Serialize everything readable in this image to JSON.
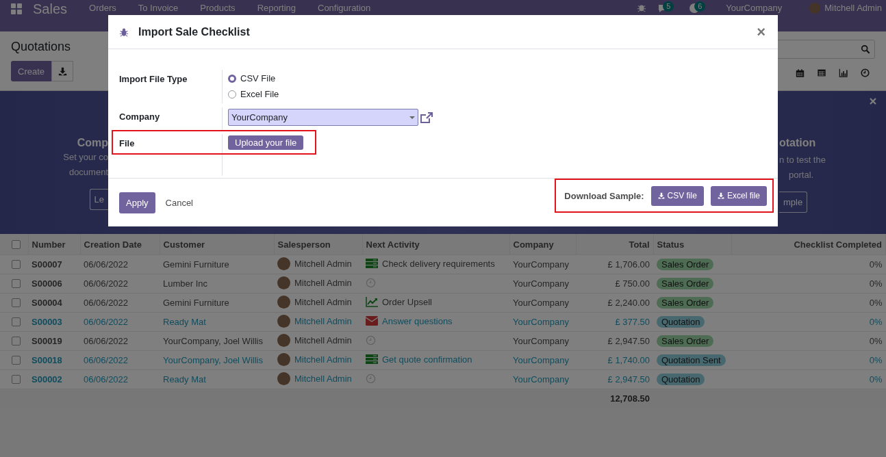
{
  "navbar": {
    "app": "Sales",
    "menu": [
      "Orders",
      "To Invoice",
      "Products",
      "Reporting",
      "Configuration"
    ],
    "chat_badge": "5",
    "activity_badge": "6",
    "company": "YourCompany",
    "user": "Mitchell Admin"
  },
  "control_panel": {
    "title": "Quotations",
    "create": "Create"
  },
  "banner": {
    "left": {
      "title": "Comp",
      "lines": [
        "Set your co",
        "document"
      ],
      "button": "Le"
    },
    "right": {
      "title": "otation",
      "lines": [
        "n to test the",
        "portal."
      ],
      "button": "mple"
    }
  },
  "table": {
    "all_checked": false,
    "columns": [
      "Number",
      "Creation Date",
      "Customer",
      "Salesperson",
      "Next Activity",
      "Company",
      "Total",
      "Status",
      "Checklist Completed"
    ],
    "rows": [
      {
        "number": "S00007",
        "date": "06/06/2022",
        "customer": "Gemini Furniture",
        "salesperson": "Mitchell Admin",
        "activity": {
          "kind": "list",
          "text": "Check delivery requirements"
        },
        "company": "YourCompany",
        "total": "£ 1,706.00",
        "status": {
          "label": "Sales Order",
          "kind": "order"
        },
        "checklist": "0%",
        "checked": false
      },
      {
        "number": "S00006",
        "date": "06/06/2022",
        "customer": "Lumber Inc",
        "salesperson": "Mitchell Admin",
        "activity": {
          "kind": "none"
        },
        "company": "YourCompany",
        "total": "£ 750.00",
        "status": {
          "label": "Sales Order",
          "kind": "order"
        },
        "checklist": "0%",
        "checked": false
      },
      {
        "number": "S00004",
        "date": "06/06/2022",
        "customer": "Gemini Furniture",
        "salesperson": "Mitchell Admin",
        "activity": {
          "kind": "chart",
          "text": "Order Upsell"
        },
        "company": "YourCompany",
        "total": "£ 2,240.00",
        "status": {
          "label": "Sales Order",
          "kind": "order"
        },
        "checklist": "0%",
        "checked": false
      },
      {
        "number": "S00003",
        "date": "06/06/2022",
        "customer": "Ready Mat",
        "salesperson": "Mitchell Admin",
        "activity": {
          "kind": "mail",
          "text": "Answer questions"
        },
        "company": "YourCompany",
        "total": "£ 377.50",
        "status": {
          "label": "Quotation",
          "kind": "quotation"
        },
        "checklist": "0%",
        "checked": false
      },
      {
        "number": "S00019",
        "date": "06/06/2022",
        "customer": "YourCompany, Joel Willis",
        "salesperson": "Mitchell Admin",
        "activity": {
          "kind": "none"
        },
        "company": "YourCompany",
        "total": "£ 2,947.50",
        "status": {
          "label": "Sales Order",
          "kind": "order"
        },
        "checklist": "0%",
        "checked": false
      },
      {
        "number": "S00018",
        "date": "06/06/2022",
        "customer": "YourCompany, Joel Willis",
        "salesperson": "Mitchell Admin",
        "activity": {
          "kind": "list",
          "text": "Get quote confirmation"
        },
        "company": "YourCompany",
        "total": "£ 1,740.00",
        "status": {
          "label": "Quotation Sent",
          "kind": "quotation"
        },
        "checklist": "0%",
        "checked": false
      },
      {
        "number": "S00002",
        "date": "06/06/2022",
        "customer": "Ready Mat",
        "salesperson": "Mitchell Admin",
        "activity": {
          "kind": "none"
        },
        "company": "YourCompany",
        "total": "£ 2,947.50",
        "status": {
          "label": "Quotation",
          "kind": "quotation"
        },
        "checklist": "0%",
        "checked": false
      }
    ],
    "sum": "12,708.50"
  },
  "dialog": {
    "title": "Import Sale Checklist",
    "close": "×",
    "file_type_label": "Import File Type",
    "file_types": [
      {
        "label": "CSV File",
        "selected": true
      },
      {
        "label": "Excel File",
        "selected": false
      }
    ],
    "company_label": "Company",
    "company_value": "YourCompany",
    "file_label": "File",
    "upload": "Upload your file",
    "apply": "Apply",
    "cancel": "Cancel",
    "sample_label": "Download Sample:",
    "samples": [
      "CSV file",
      "Excel file"
    ]
  }
}
